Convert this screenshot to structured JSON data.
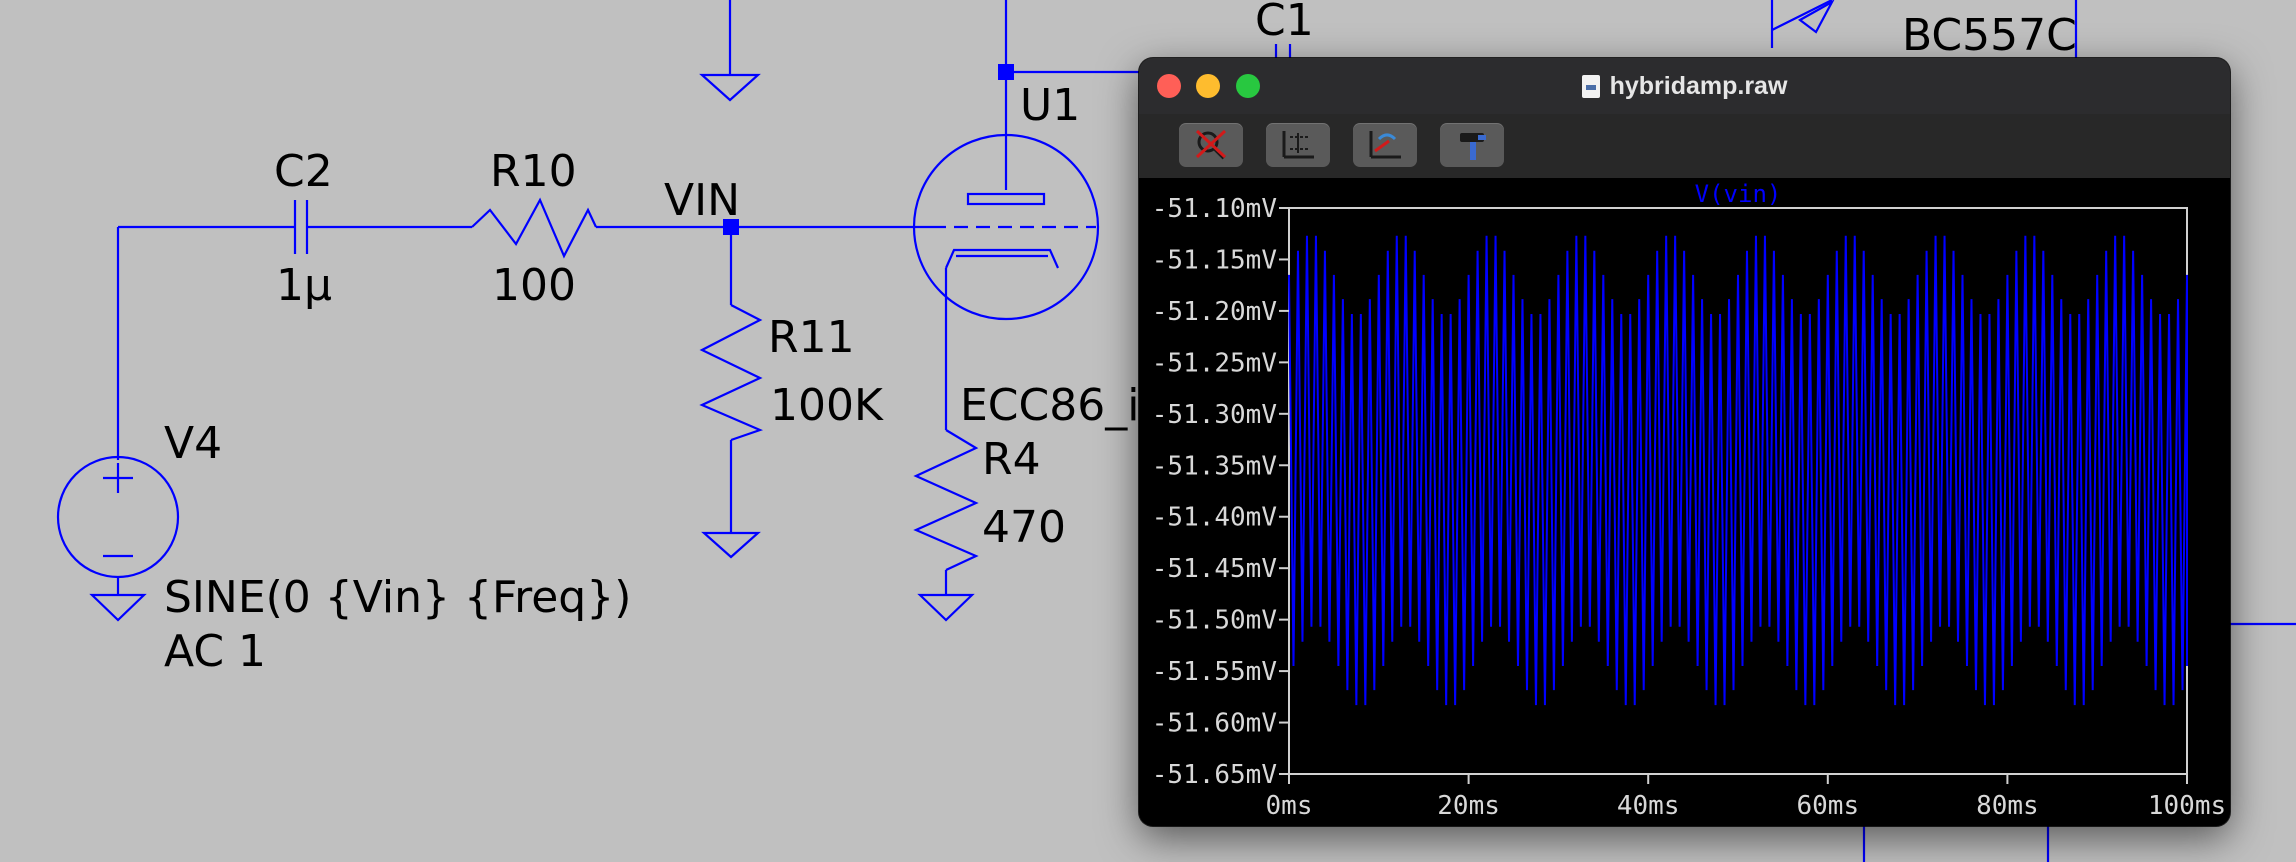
{
  "schematic": {
    "labels": {
      "c1": "C1",
      "bc557c": "BC557C",
      "u1": "U1",
      "c2": "C2",
      "c2_value": "1μ",
      "r10": "R10",
      "r10_value": "100",
      "vin_net": "VIN",
      "r11": "R11",
      "r11_value": "100K",
      "ecc86": "ECC86_i",
      "r4": "R4",
      "r4_value": "470",
      "v4": "V4",
      "v4_func": "SINE(0 {Vin} {Freq})",
      "v4_ac": "AC 1"
    },
    "wire_color": "#0000ff",
    "background_color": "#c0c0c0"
  },
  "window": {
    "title": "hybridamp.raw",
    "toolbar": [
      {
        "icon": "zoom-cancel-icon"
      },
      {
        "icon": "autorange-icon"
      },
      {
        "icon": "zoom-back-icon"
      },
      {
        "icon": "hammer-icon"
      }
    ],
    "colors": {
      "close": "#ff5f57",
      "minimize": "#febc2e",
      "maximize": "#28c840",
      "plot_bg": "#000000",
      "trace": "#0000ff"
    }
  },
  "chart_data": {
    "type": "line",
    "title": "V(vin)",
    "xlabel": "",
    "ylabel": "",
    "x_ticks": [
      "0ms",
      "20ms",
      "40ms",
      "60ms",
      "80ms",
      "100ms"
    ],
    "y_ticks": [
      "-51.10mV",
      "-51.15mV",
      "-51.20mV",
      "-51.25mV",
      "-51.30mV",
      "-51.35mV",
      "-51.40mV",
      "-51.45mV",
      "-51.50mV",
      "-51.55mV",
      "-51.60mV",
      "-51.65mV"
    ],
    "xlim_ms": [
      0,
      100
    ],
    "ylim_mV": [
      -51.65,
      -51.1
    ],
    "series": [
      {
        "name": "V(vin)",
        "color": "#0000ff",
        "oscillation_period_ms": 1.0,
        "envelope_period_ms": 10,
        "upper_envelope_mV": {
          "mean": -51.165,
          "amplitude": 0.04
        },
        "lower_envelope_mV": {
          "mean": -51.545,
          "amplitude": 0.04
        }
      }
    ],
    "grid": false
  }
}
